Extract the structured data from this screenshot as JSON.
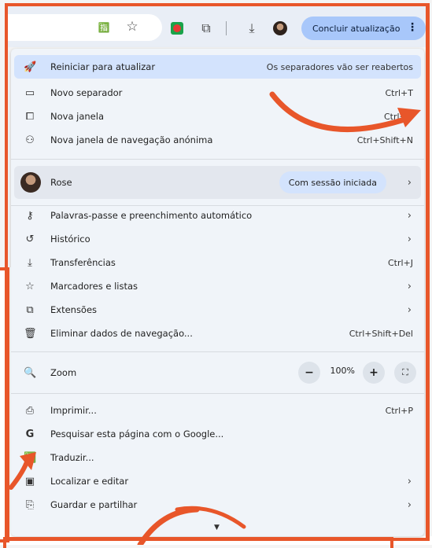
{
  "toolbar": {
    "update_label": "Concluir atualização",
    "menu_dots": "⋮"
  },
  "icons": {
    "translate": "🈯",
    "star": "☆",
    "extension": "⧉",
    "download": "⤓"
  },
  "menu": {
    "restart": {
      "label": "Reiniciar para atualizar",
      "hint": "Os separadores vão ser reabertos"
    },
    "items1": [
      {
        "label": "Novo separador",
        "shortcut": "Ctrl+T"
      },
      {
        "label": "Nova janela",
        "shortcut": "Ctrl+N"
      },
      {
        "label": "Nova janela de navegação anónima",
        "shortcut": "Ctrl+Shift+N"
      }
    ],
    "profile": {
      "name": "Rose",
      "status": "Com sessão iniciada"
    },
    "items2": [
      {
        "label": "Palavras-passe e preenchimento automático"
      },
      {
        "label": "Histórico"
      },
      {
        "label": "Transferências",
        "shortcut": "Ctrl+J"
      },
      {
        "label": "Marcadores e listas"
      },
      {
        "label": "Extensões"
      },
      {
        "label": "Eliminar dados de navegação...",
        "shortcut": "Ctrl+Shift+Del"
      }
    ],
    "zoom": {
      "label": "Zoom",
      "value": "100%",
      "minus": "−",
      "plus": "+"
    },
    "items3": [
      {
        "label": "Imprimir...",
        "shortcut": "Ctrl+P"
      },
      {
        "label": "Pesquisar esta página com o Google..."
      },
      {
        "label": "Traduzir..."
      },
      {
        "label": "Localizar e editar"
      },
      {
        "label": "Guardar e partilhar"
      }
    ]
  }
}
